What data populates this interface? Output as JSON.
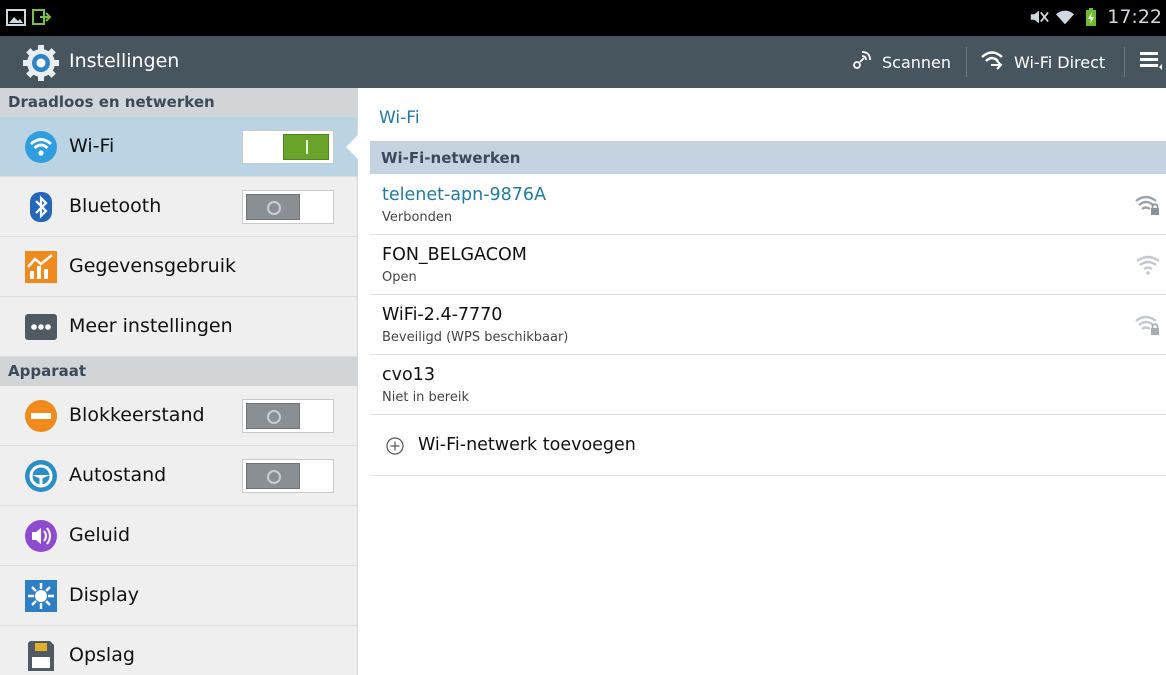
{
  "status_bar": {
    "time": "17:22",
    "icons": [
      "gallery-icon",
      "usb-icon",
      "mute-icon",
      "wifi-signal-icon",
      "battery-charging-icon"
    ]
  },
  "action_bar": {
    "title": "Instellingen",
    "scan_label": "Scannen",
    "wifi_direct_label": "Wi-Fi Direct",
    "icons": [
      "settings-gear-icon",
      "scan-icon",
      "wifi-direct-icon",
      "menu-icon"
    ]
  },
  "sidebar": {
    "sections": [
      {
        "header": "Draadloos en netwerken",
        "items": [
          {
            "label": "Wi-Fi",
            "icon": "wifi-icon",
            "toggle": "on",
            "selected": true
          },
          {
            "label": "Bluetooth",
            "icon": "bluetooth-icon",
            "toggle": "off"
          },
          {
            "label": "Gegevensgebruik",
            "icon": "data-usage-icon"
          },
          {
            "label": "Meer instellingen",
            "icon": "more-icon"
          }
        ]
      },
      {
        "header": "Apparaat",
        "items": [
          {
            "label": "Blokkeerstand",
            "icon": "block-icon",
            "toggle": "off"
          },
          {
            "label": "Autostand",
            "icon": "car-icon",
            "toggle": "off"
          },
          {
            "label": "Geluid",
            "icon": "sound-icon"
          },
          {
            "label": "Display",
            "icon": "display-icon"
          },
          {
            "label": "Opslag",
            "icon": "storage-icon"
          }
        ]
      }
    ]
  },
  "main": {
    "title": "Wi-Fi",
    "networks_header": "Wi-Fi-netwerken",
    "networks": [
      {
        "name": "telenet-apn-9876A",
        "status": "Verbonden",
        "connected": true,
        "secured": true
      },
      {
        "name": "FON_BELGACOM",
        "status": "Open",
        "connected": false,
        "secured": false
      },
      {
        "name": "WiFi-2.4-7770",
        "status": "Beveiligd (WPS beschikbaar)",
        "connected": false,
        "secured": true
      },
      {
        "name": "cvo13",
        "status": "Niet in bereik",
        "connected": false,
        "secured": false,
        "in_range": false
      }
    ],
    "add_network_label": "Wi-Fi-netwerk toevoegen"
  },
  "colors": {
    "action_bar": "#47555f",
    "accent_blue": "#1f7aa8",
    "selected_item": "#bbd4e4",
    "toggle_on": "#6aa329",
    "toggle_off": "#8a8f93"
  }
}
